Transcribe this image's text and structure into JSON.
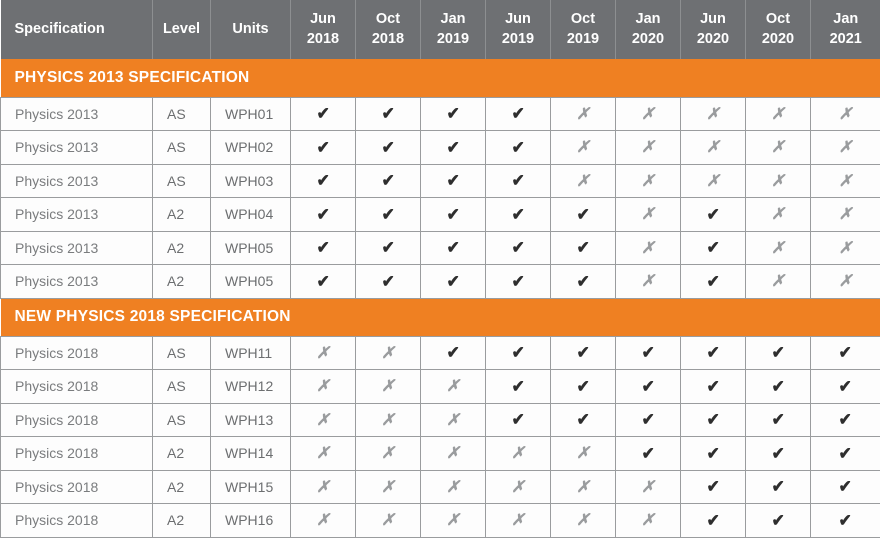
{
  "table": {
    "columns": [
      {
        "label": "Specification",
        "type": "text"
      },
      {
        "label": "Level",
        "type": "text"
      },
      {
        "label": "Units",
        "type": "text"
      },
      {
        "month": "Jun",
        "year": "2018",
        "type": "date"
      },
      {
        "month": "Oct",
        "year": "2018",
        "type": "date"
      },
      {
        "month": "Jan",
        "year": "2019",
        "type": "date"
      },
      {
        "month": "Jun",
        "year": "2019",
        "type": "date"
      },
      {
        "month": "Oct",
        "year": "2019",
        "type": "date"
      },
      {
        "month": "Jan",
        "year": "2020",
        "type": "date"
      },
      {
        "month": "Jun",
        "year": "2020",
        "type": "date"
      },
      {
        "month": "Oct",
        "year": "2020",
        "type": "date"
      },
      {
        "month": "Jan",
        "year": "2021",
        "type": "date"
      }
    ],
    "marks": {
      "yes": "✔",
      "no": "✗"
    },
    "colors": {
      "header_background": "#6e7073",
      "header_text": "#ffffff",
      "section_banner_background": "#ef8022",
      "section_banner_text": "#ffffff",
      "cell_text": "#6c6e70",
      "grid_line": "#9a9c9e",
      "mark_yes": "#2e2e2e",
      "mark_no": "#9a9c9e"
    },
    "sections": [
      {
        "title": "PHYSICS 2013 SPECIFICATION",
        "rows": [
          {
            "specification": "Physics 2013",
            "level": "AS",
            "unit": "WPH01",
            "availability": [
              "yes",
              "yes",
              "yes",
              "yes",
              "no",
              "no",
              "no",
              "no",
              "no"
            ]
          },
          {
            "specification": "Physics 2013",
            "level": "AS",
            "unit": "WPH02",
            "availability": [
              "yes",
              "yes",
              "yes",
              "yes",
              "no",
              "no",
              "no",
              "no",
              "no"
            ]
          },
          {
            "specification": "Physics 2013",
            "level": "AS",
            "unit": "WPH03",
            "availability": [
              "yes",
              "yes",
              "yes",
              "yes",
              "no",
              "no",
              "no",
              "no",
              "no"
            ]
          },
          {
            "specification": "Physics 2013",
            "level": "A2",
            "unit": "WPH04",
            "availability": [
              "yes",
              "yes",
              "yes",
              "yes",
              "yes",
              "no",
              "yes",
              "no",
              "no"
            ]
          },
          {
            "specification": "Physics 2013",
            "level": "A2",
            "unit": "WPH05",
            "availability": [
              "yes",
              "yes",
              "yes",
              "yes",
              "yes",
              "no",
              "yes",
              "no",
              "no"
            ]
          },
          {
            "specification": "Physics 2013",
            "level": "A2",
            "unit": "WPH05",
            "availability": [
              "yes",
              "yes",
              "yes",
              "yes",
              "yes",
              "no",
              "yes",
              "no",
              "no"
            ]
          }
        ]
      },
      {
        "title": "NEW PHYSICS 2018 SPECIFICATION",
        "rows": [
          {
            "specification": "Physics 2018",
            "level": "AS",
            "unit": "WPH11",
            "availability": [
              "no",
              "no",
              "yes",
              "yes",
              "yes",
              "yes",
              "yes",
              "yes",
              "yes"
            ]
          },
          {
            "specification": "Physics 2018",
            "level": "AS",
            "unit": "WPH12",
            "availability": [
              "no",
              "no",
              "no",
              "yes",
              "yes",
              "yes",
              "yes",
              "yes",
              "yes"
            ]
          },
          {
            "specification": "Physics 2018",
            "level": "AS",
            "unit": "WPH13",
            "availability": [
              "no",
              "no",
              "no",
              "yes",
              "yes",
              "yes",
              "yes",
              "yes",
              "yes"
            ]
          },
          {
            "specification": "Physics 2018",
            "level": "A2",
            "unit": "WPH14",
            "availability": [
              "no",
              "no",
              "no",
              "no",
              "no",
              "yes",
              "yes",
              "yes",
              "yes"
            ]
          },
          {
            "specification": "Physics 2018",
            "level": "A2",
            "unit": "WPH15",
            "availability": [
              "no",
              "no",
              "no",
              "no",
              "no",
              "no",
              "yes",
              "yes",
              "yes"
            ]
          },
          {
            "specification": "Physics 2018",
            "level": "A2",
            "unit": "WPH16",
            "availability": [
              "no",
              "no",
              "no",
              "no",
              "no",
              "no",
              "yes",
              "yes",
              "yes"
            ]
          }
        ]
      }
    ]
  }
}
